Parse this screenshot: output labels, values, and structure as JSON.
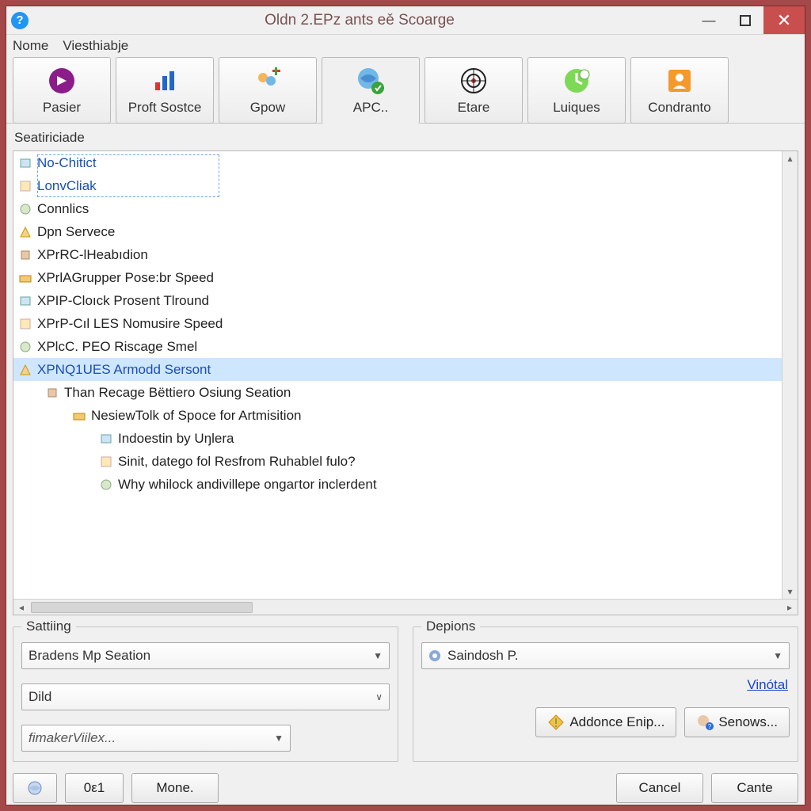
{
  "titlebar": {
    "title": "Oldn 2.EPz ants eě Scoarge"
  },
  "menu": {
    "items": [
      "Nome",
      "Viesthiabje"
    ]
  },
  "toolbar": {
    "items": [
      {
        "label": "Pasier"
      },
      {
        "label": "Proft Sostce"
      },
      {
        "label": "Gpow"
      },
      {
        "label": "APC.."
      },
      {
        "label": "Etare"
      },
      {
        "label": "Luiques"
      },
      {
        "label": "Condranto"
      }
    ]
  },
  "tree": {
    "heading": "Seatiriciade",
    "items": [
      {
        "label": "No-Chitict",
        "level": 0,
        "hl": true
      },
      {
        "label": "LonvCliak",
        "level": 0,
        "hl": true
      },
      {
        "label": "Connlics",
        "level": 0
      },
      {
        "label": "Dpn Servece",
        "level": 0
      },
      {
        "label": "XPrRC-lHeabıdion",
        "level": 0
      },
      {
        "label": "XPrlAGrupper Pose:br Speed",
        "level": 0
      },
      {
        "label": "XPIP-Cloıck Prosent Tlround",
        "level": 0
      },
      {
        "label": "XPrP-Cıl LES Nomusire Speed",
        "level": 0
      },
      {
        "label": "XPlcC. PEO Riscage Smel",
        "level": 0
      },
      {
        "label": "XPNQ1UES Armodd Sersont",
        "level": 0,
        "sel": true,
        "hl": true
      },
      {
        "label": "Than Recage Bëttiero Osiung Seation",
        "level": 1
      },
      {
        "label": "NesiewTolk of Spoce for Artmisition",
        "level": 2
      },
      {
        "label": "Indoestin by Uŋlera",
        "level": 3
      },
      {
        "label": "Sinit, datego fol Resfrom Ruhablel fulo?",
        "level": 3
      },
      {
        "label": "Why whilock andivillepe ongaгtor inclerdent",
        "level": 3
      }
    ]
  },
  "form": {
    "setting_legend": "Sattiing",
    "depions_legend": "Depions",
    "setting_combo": "Bradens Mp Seation",
    "did_combo": "Dild",
    "maker_combo": "fimakerViilex...",
    "depions_combo": "Saindosh P.",
    "vinotal_link": "Vinótal",
    "addonce_btn": "Addonce Enip...",
    "senows_btn": "Senows..."
  },
  "footer": {
    "small_btn": "0ε1",
    "mone_btn": "Mone.",
    "cancel_btn": "Cancel",
    "cante_btn": "Cante"
  }
}
